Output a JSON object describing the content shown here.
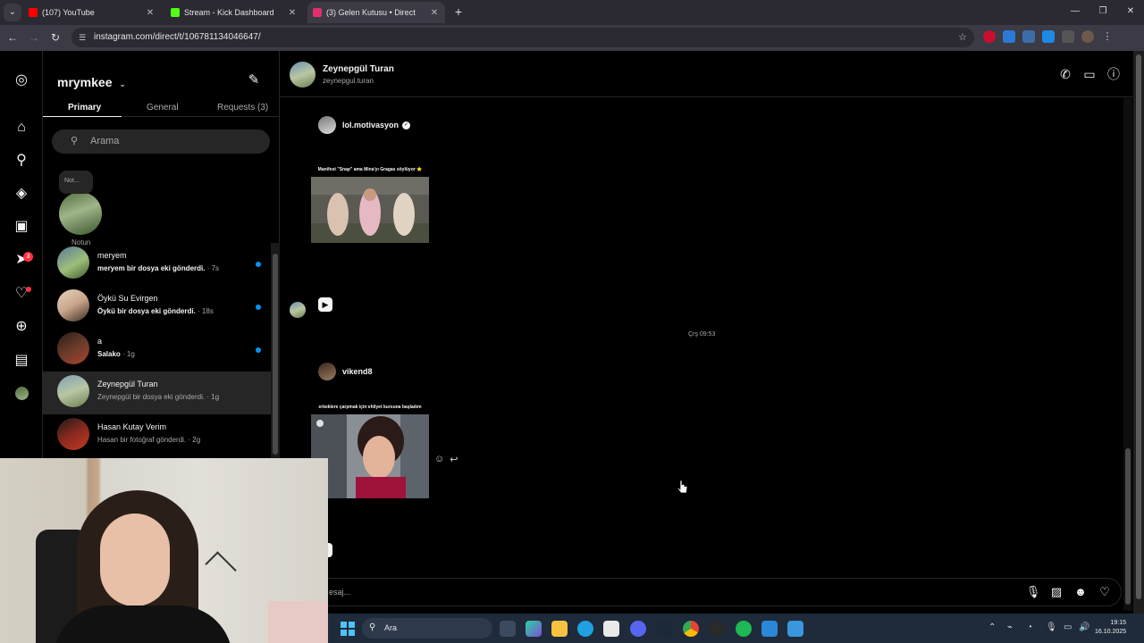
{
  "browser": {
    "tabs": [
      {
        "title": "(107) YouTube",
        "favicon_color": "#ff0000",
        "active": false
      },
      {
        "title": "Stream - Kick Dashboard",
        "favicon_color": "#53fc18",
        "active": false
      },
      {
        "title": "(3) Gelen Kutusu • Direct",
        "favicon_color": "#e1306c",
        "active": true
      }
    ],
    "url": "instagram.com/direct/t/106781134046647/"
  },
  "nav": {
    "notifications_badge": "3"
  },
  "inbox": {
    "username": "mrymkee",
    "tabs": [
      "Primary",
      "General",
      "Requests (3)"
    ],
    "search_placeholder": "Arama",
    "note_text": "Not...",
    "note_label": "Notun",
    "conversations": [
      {
        "name": "meryem",
        "preview": "meryem bir dosya eki gönderdi.",
        "time": " · 7s",
        "unread": true,
        "avatar_color": "#5a7a9a"
      },
      {
        "name": "Öykü Su Evirgen",
        "preview": "Öykü bir dosya eki gönderdi.",
        "time": " · 18s",
        "unread": true,
        "avatar_color": "#c9a58a"
      },
      {
        "name": "a",
        "preview": "Salako",
        "time": " · 1g",
        "unread": true,
        "avatar_color": "#6b3b2a"
      },
      {
        "name": "Zeynepgül Turan",
        "preview": "Zeynepgül bir dosya eki gönderdi.",
        "time": " · 1g",
        "unread": false,
        "avatar_color": "#7f9fb8"
      },
      {
        "name": "Hasan Kutay Verim",
        "preview": "Hasan bir fotoğraf gönderdi.",
        "time": " · 2g",
        "unread": false,
        "avatar_color": "#8a2a1e"
      }
    ]
  },
  "chat": {
    "name": "Zeynepgül Turan",
    "handle": "zeynepgul.turan",
    "messages": [
      {
        "sender": "lol.motivasyon",
        "verified": true,
        "caption": "Manifest \"Snap\" ama Mina'yı Gragas söylüyor ⭐"
      },
      {
        "sender": "vikend8",
        "verified": false,
        "caption": "erkeklere çarpmak için ehliyet kursuna başladım"
      }
    ],
    "timestamp": "Çrş 09:53",
    "composer_placeholder": "esaj..."
  },
  "taskbar": {
    "search_placeholder": "Ara",
    "time": "19:15",
    "date": "16.10.2025"
  }
}
